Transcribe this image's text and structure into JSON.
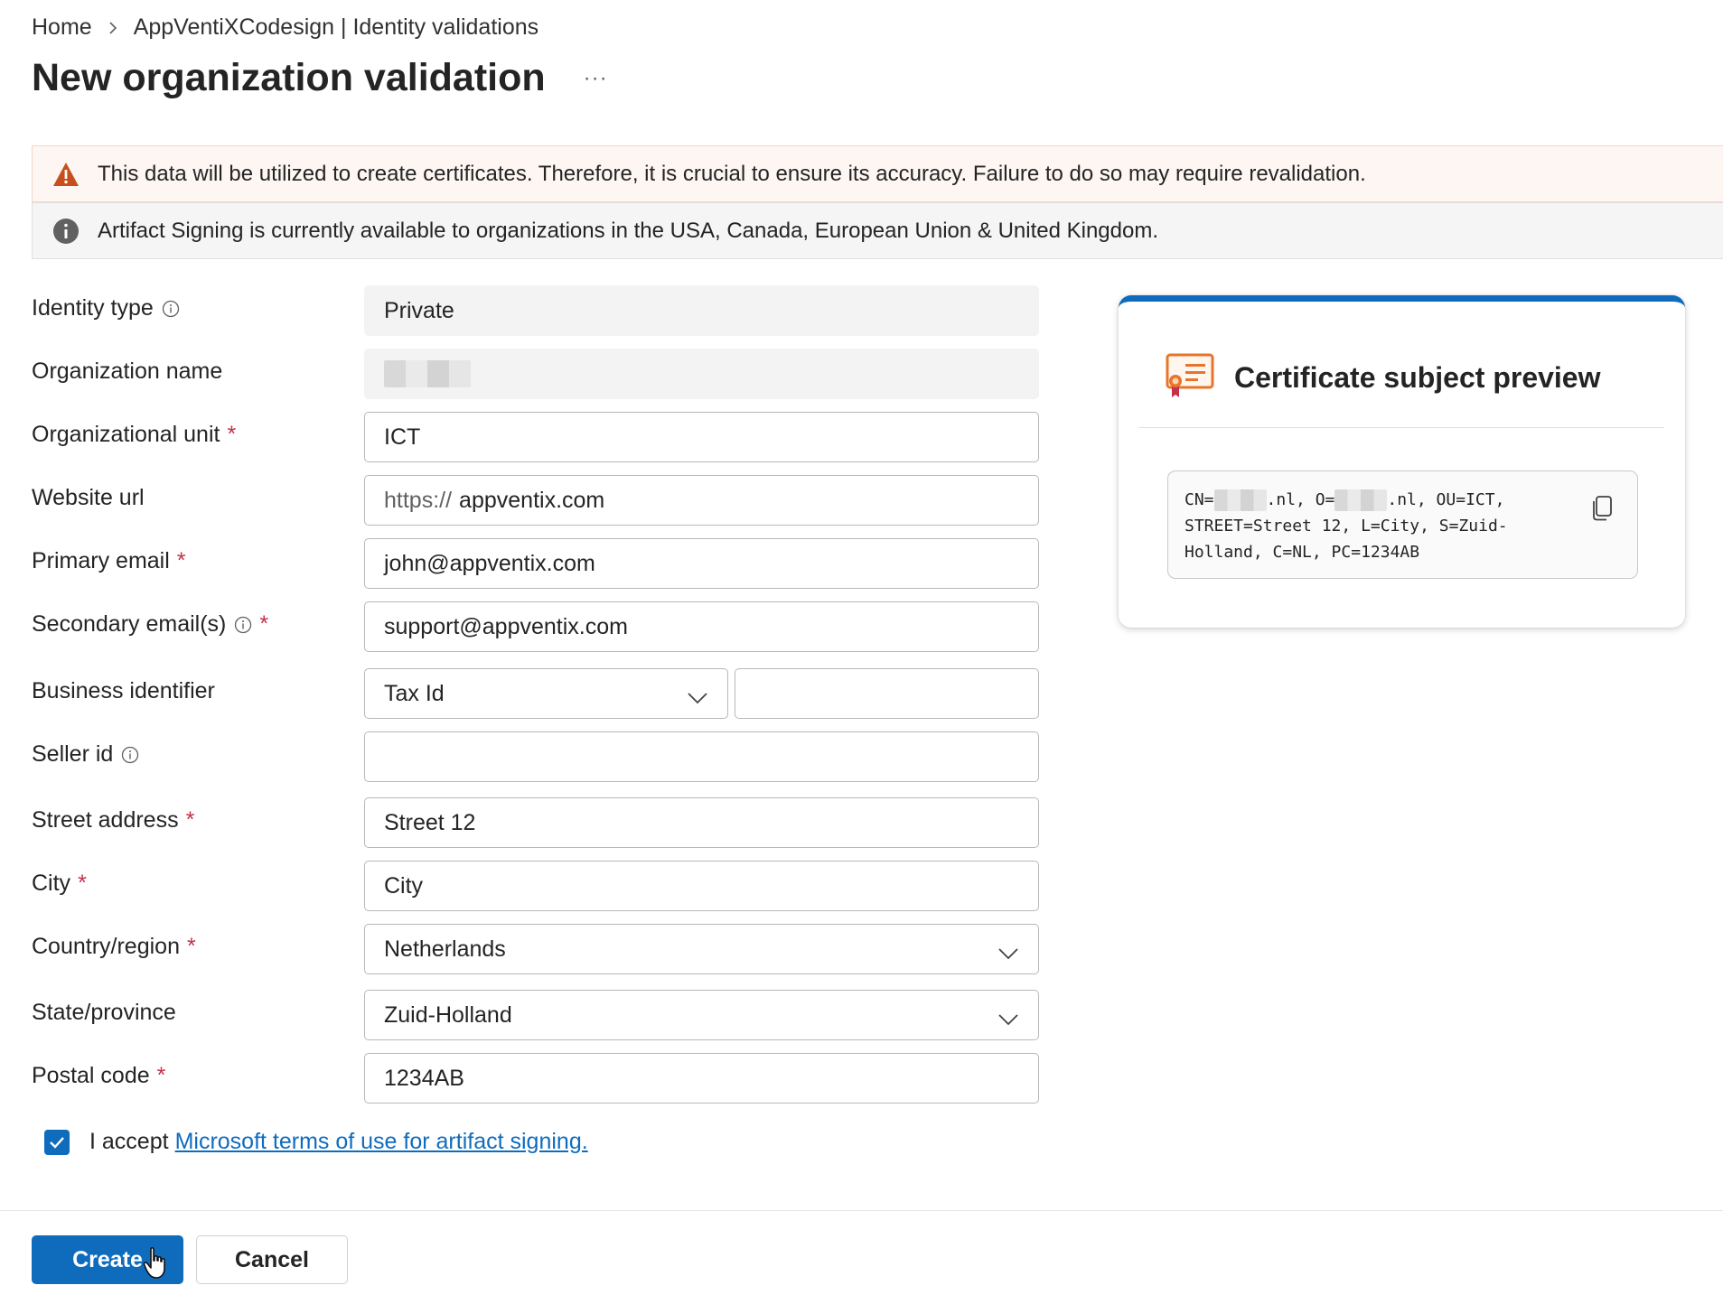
{
  "breadcrumb": {
    "home": "Home",
    "current": "AppVentiXCodesign | Identity validations"
  },
  "page": {
    "title": "New organization validation",
    "more": "···"
  },
  "banners": {
    "warning": "This data will be utilized to create certificates. Therefore, it is crucial to ensure its accuracy. Failure to do so may require revalidation.",
    "info": "Artifact Signing is currently available to organizations in the USA, Canada, European Union & United Kingdom."
  },
  "form": {
    "identity_type": {
      "label": "Identity type",
      "value": "Private"
    },
    "organization_name": {
      "label": "Organization name"
    },
    "organizational_unit": {
      "label": "Organizational unit",
      "value": "ICT"
    },
    "website_url": {
      "label": "Website url",
      "prefix": "https://",
      "value": "appventix.com"
    },
    "primary_email": {
      "label": "Primary email",
      "value": "john@appventix.com"
    },
    "secondary_emails": {
      "label": "Secondary email(s)",
      "value": "support@appventix.com"
    },
    "business_identifier": {
      "label": "Business identifier",
      "type_value": "Tax Id",
      "value": ""
    },
    "seller_id": {
      "label": "Seller id",
      "value": ""
    },
    "street_address": {
      "label": "Street address",
      "value": "Street 12"
    },
    "city": {
      "label": "City",
      "value": "City"
    },
    "country_region": {
      "label": "Country/region",
      "value": "Netherlands"
    },
    "state_province": {
      "label": "State/province",
      "value": "Zuid-Holland"
    },
    "postal_code": {
      "label": "Postal code",
      "value": "1234AB"
    },
    "required_marker": "*"
  },
  "terms": {
    "prefix": "I accept",
    "link": "Microsoft terms of use for artifact signing.",
    "checked": true
  },
  "buttons": {
    "create": "Create",
    "cancel": "Cancel"
  },
  "preview": {
    "title": "Certificate subject preview",
    "cn_prefix": "CN=",
    "cn_suffix": ".nl, O=",
    "o_suffix": ".nl, OU=ICT,",
    "line2": "STREET=Street 12, L=City, S=Zuid-",
    "line3": "Holland, C=NL, PC=1234AB"
  },
  "colors": {
    "accent": "#0f6cbd",
    "warning": "#c5501b",
    "required": "#c4314b",
    "cert_orange": "#e8742b"
  }
}
